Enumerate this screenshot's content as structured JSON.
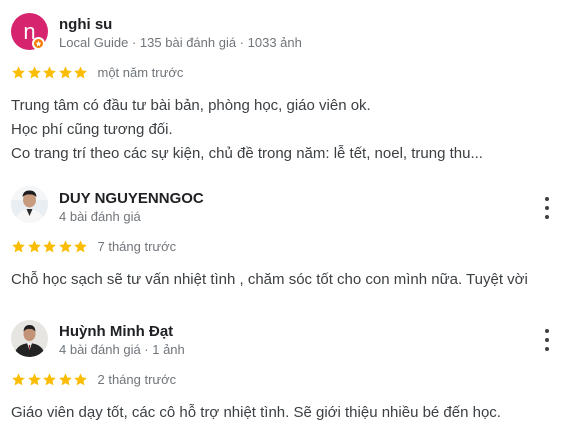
{
  "colors": {
    "star": "#fbbc04",
    "avatar_bg": "#d6246e",
    "badge": "#f57c00",
    "meta_text": "#70757a"
  },
  "reviews": [
    {
      "avatar_letter": "n",
      "name": "nghi su",
      "meta": "Local Guide · 135 bài đánh giá · 1033 ảnh",
      "rating": 5,
      "when": "một năm trước",
      "text_lines": [
        "Trung tâm có đầu tư bài bản, phòng học, giáo viên ok.",
        "Học phí cũng tương đối.",
        "Co trang trí theo các sự kiện, chủ đề trong năm: lễ tết, noel, trung thu..."
      ]
    },
    {
      "name": "DUY NGUYENNGOC",
      "meta": "4 bài đánh giá",
      "rating": 5,
      "when": "7 tháng trước",
      "text_lines": [
        "Chỗ học sạch sẽ tư vấn nhiệt tình , chăm sóc tốt cho con mình nữa. Tuyệt vời"
      ]
    },
    {
      "name": "Huỳnh Minh Đạt",
      "meta": "4 bài đánh giá · 1 ảnh",
      "rating": 5,
      "when": "2 tháng trước",
      "text_lines": [
        "Giáo viên dạy tốt, các cô hỗ trợ nhiệt tình. Sẽ giới thiệu nhiều bé đến học."
      ]
    }
  ]
}
